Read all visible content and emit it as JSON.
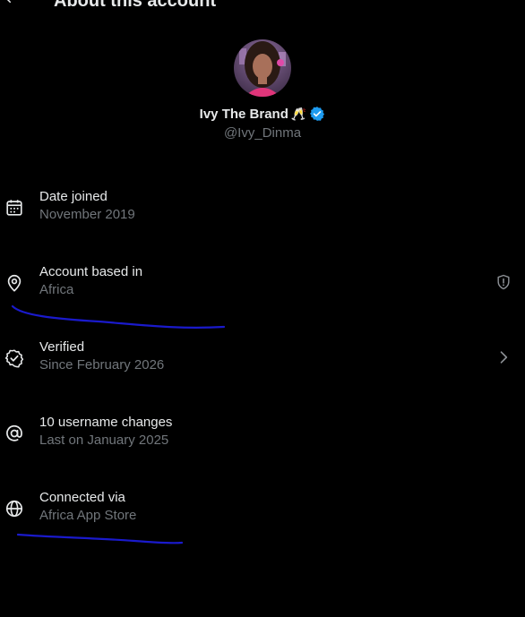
{
  "header": {
    "title": "About this account",
    "back_icon": "arrow-left-icon"
  },
  "profile": {
    "display_name": "Ivy The Brand",
    "name_emoji": "🥂",
    "verified_badge_icon": "verified-badge-icon",
    "handle": "@Ivy_Dinma"
  },
  "details": [
    {
      "icon": "calendar-icon",
      "title": "Date joined",
      "subtitle": "November 2019"
    },
    {
      "icon": "location-pin-icon",
      "title": "Account based in",
      "subtitle": "Africa",
      "trailing_icon": "shield-info-icon"
    },
    {
      "icon": "verified-check-icon",
      "title": "Verified",
      "subtitle": "Since February 2026",
      "trailing_icon": "chevron-right-icon"
    },
    {
      "icon": "at-sign-icon",
      "title": "10 username changes",
      "subtitle": "Last on January 2025"
    },
    {
      "icon": "globe-icon",
      "title": "Connected via",
      "subtitle": "Africa App Store"
    }
  ],
  "colors": {
    "background": "#000000",
    "primary_text": "#e7e9ea",
    "secondary_text": "#71767b",
    "verified_blue": "#1d9bf0",
    "annotation_ink": "#1a1acc"
  }
}
